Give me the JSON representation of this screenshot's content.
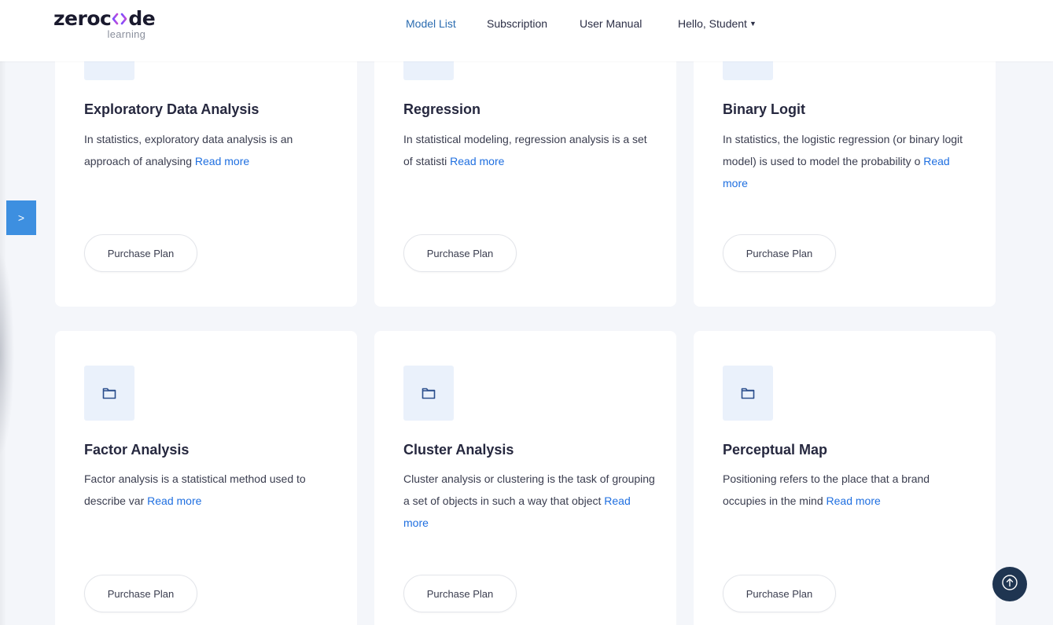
{
  "brand": {
    "name_part1": "zeroc",
    "name_part2": "de",
    "tagline": "learning",
    "mark_icon": "code-brackets-icon"
  },
  "nav": {
    "items": [
      {
        "label": "Model List",
        "active": true
      },
      {
        "label": "Subscription",
        "active": false
      },
      {
        "label": "User Manual",
        "active": false
      }
    ],
    "user_menu": {
      "label": "Hello, Student",
      "icon": "caret-down-icon"
    }
  },
  "sidebar": {
    "toggle_label": ">"
  },
  "cards": [
    {
      "title": "Exploratory Data Analysis",
      "desc": "In statistics, exploratory data analysis is an approach of analysing",
      "read_more": "Read more",
      "button": "Purchase Plan",
      "icon": "folder-icon"
    },
    {
      "title": "Regression",
      "desc": "In statistical modeling, regression analysis is a set of statisti",
      "read_more": "Read more",
      "button": "Purchase Plan",
      "icon": "folder-icon"
    },
    {
      "title": "Binary Logit",
      "desc": "In statistics, the logistic regression (or binary logit model) is used to model the probability o",
      "read_more": "Read more",
      "button": "Purchase Plan",
      "icon": "folder-icon"
    },
    {
      "title": "Factor Analysis",
      "desc": "Factor analysis is a statistical method used to describe var",
      "read_more": "Read more",
      "button": "Purchase Plan",
      "icon": "folder-icon"
    },
    {
      "title": "Cluster Analysis",
      "desc": "Cluster analysis or clustering is the task of grouping a set of objects in such a way that object",
      "read_more": "Read more",
      "button": "Purchase Plan",
      "icon": "folder-icon"
    },
    {
      "title": "Perceptual Map",
      "desc": "Positioning refers to the place that a brand occupies in the mind",
      "read_more": "Read more",
      "button": "Purchase Plan",
      "icon": "folder-icon"
    }
  ],
  "scroll_top": {
    "icon": "arrow-up-circle-icon"
  },
  "colors": {
    "accent": "#2b6cb0",
    "link": "#1f6fe0",
    "sidebar_toggle": "#3d8fe0",
    "scroll_top_bg": "#1f3551",
    "background": "#f4f6fa"
  }
}
